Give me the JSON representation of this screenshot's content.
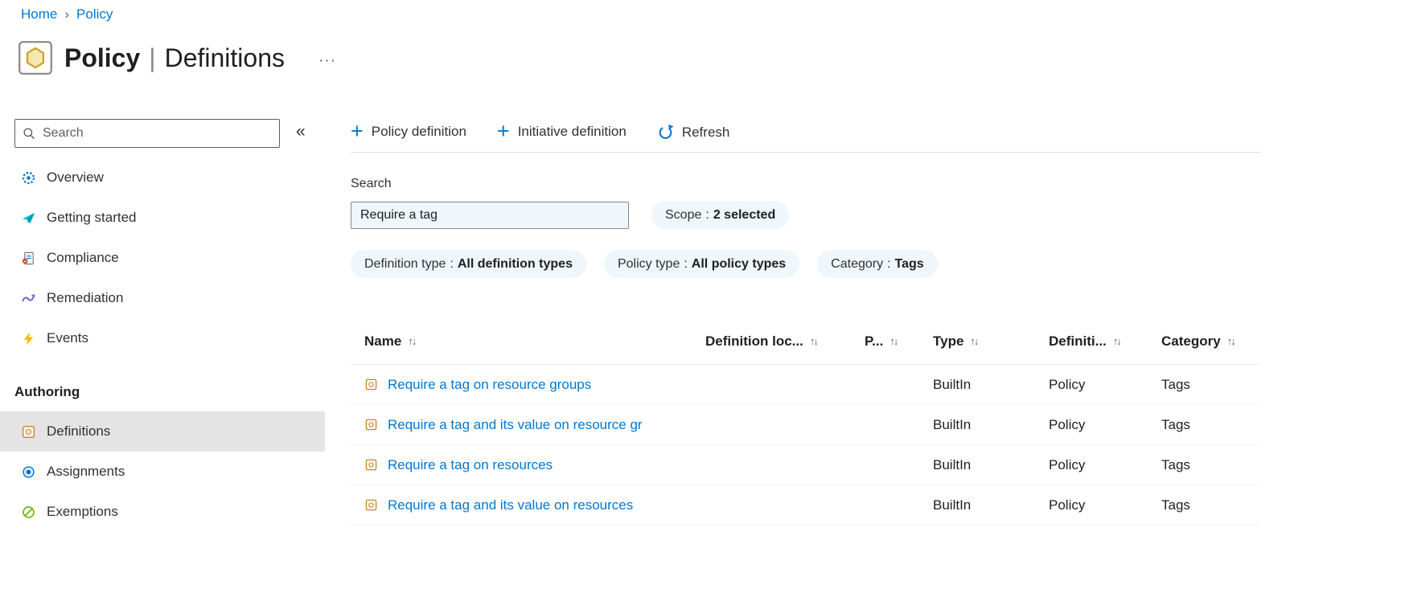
{
  "icons": {
    "breadcrumb_chevron": "›",
    "collapse": "«",
    "plus": "+",
    "sort": "↑↓",
    "more": "···",
    "pill_separator": ":"
  },
  "breadcrumb": {
    "items": [
      {
        "label": "Home"
      },
      {
        "label": "Policy"
      }
    ]
  },
  "header": {
    "title_primary": "Policy",
    "title_separator": "|",
    "title_secondary": "Definitions"
  },
  "sidebar": {
    "search_placeholder": "Search",
    "items": [
      {
        "label": "Overview",
        "icon": "overview-icon"
      },
      {
        "label": "Getting started",
        "icon": "getting-started-icon"
      },
      {
        "label": "Compliance",
        "icon": "compliance-icon"
      },
      {
        "label": "Remediation",
        "icon": "remediation-icon"
      },
      {
        "label": "Events",
        "icon": "events-icon"
      }
    ],
    "section_label": "Authoring",
    "authoring_items": [
      {
        "label": "Definitions",
        "icon": "definitions-icon",
        "selected": true
      },
      {
        "label": "Assignments",
        "icon": "assignments-icon",
        "selected": false
      },
      {
        "label": "Exemptions",
        "icon": "exemptions-icon",
        "selected": false
      }
    ]
  },
  "toolbar": {
    "policy_definition": "Policy definition",
    "initiative_definition": "Initiative definition",
    "refresh": "Refresh"
  },
  "filters": {
    "search_label": "Search",
    "search_value": "Require a tag",
    "pills": [
      {
        "name": "Scope",
        "value": "2 selected"
      },
      {
        "name": "Definition type",
        "value": "All definition types"
      },
      {
        "name": "Policy type",
        "value": "All policy types"
      },
      {
        "name": "Category",
        "value": "Tags"
      }
    ]
  },
  "table": {
    "columns": [
      "Name",
      "Definition loc...",
      "P...",
      "Type",
      "Definiti...",
      "Category"
    ],
    "rows": [
      {
        "name": "Require a tag on resource groups",
        "type": "BuiltIn",
        "definition_type": "Policy",
        "category": "Tags"
      },
      {
        "name": "Require a tag and its value on resource gr",
        "type": "BuiltIn",
        "definition_type": "Policy",
        "category": "Tags"
      },
      {
        "name": "Require a tag on resources",
        "type": "BuiltIn",
        "definition_type": "Policy",
        "category": "Tags"
      },
      {
        "name": "Require a tag and its value on resources",
        "type": "BuiltIn",
        "definition_type": "Policy",
        "category": "Tags"
      }
    ]
  },
  "colors": {
    "accent": "#0078d4",
    "link": "#0078d4",
    "pill_background": "#eff6fc",
    "selected_item_background": "#e4e4e4"
  }
}
